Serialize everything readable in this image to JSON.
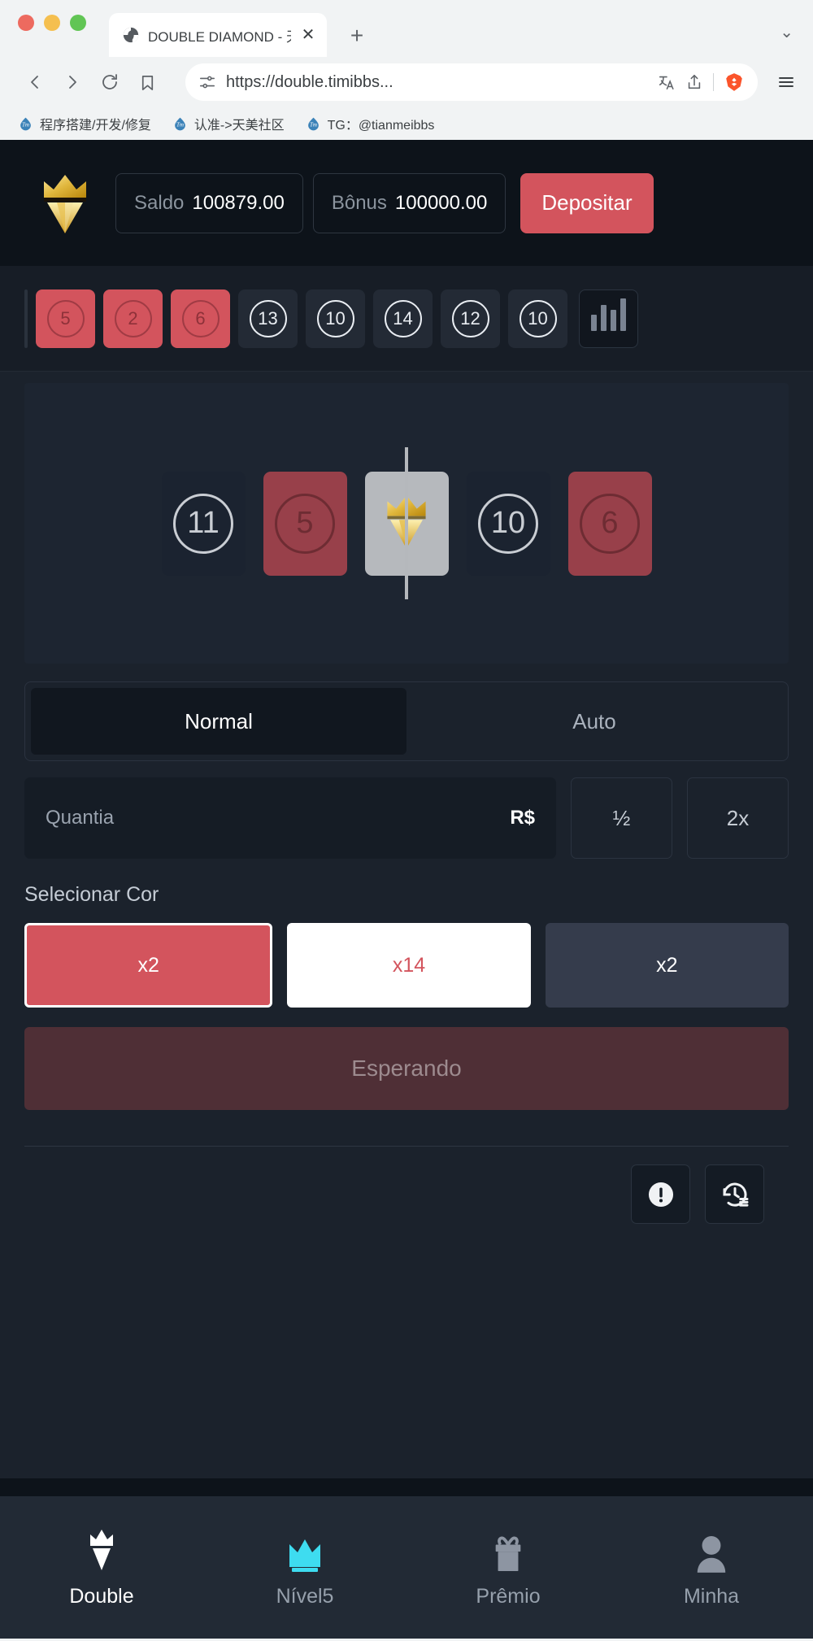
{
  "browser": {
    "tab": {
      "title": "DOUBLE DIAMOND - 天美社区",
      "favicon_icon": "globe-icon",
      "close_label": "✕"
    },
    "new_tab_label": "+",
    "tab_list_label": "⌄",
    "nav": {
      "back_icon": "back-arrow-icon",
      "forward_icon": "forward-arrow-icon",
      "reload_icon": "reload-icon",
      "bookmark_icon": "bookmark-icon"
    },
    "omnibox": {
      "url": "https://double.timibbs...",
      "permissions_icon": "page-settings-icon",
      "translate_icon": "translate-icon",
      "share_icon": "share-icon",
      "shield_icon": "brave-lion-icon"
    },
    "menu_icon": "hamburger-menu-icon",
    "bookmarks": [
      {
        "label": "程序搭建/开发/修复",
        "icon": "tm-bookmark-icon"
      },
      {
        "label": "认准->天美社区",
        "icon": "tm-bookmark-icon"
      },
      {
        "label": "TG：@tianmeibbs",
        "icon": "tm-bookmark-icon"
      }
    ]
  },
  "app": {
    "logo_icon": "gold-crown-diamond-logo",
    "header": {
      "balance_label": "Saldo",
      "balance_value": "100879.00",
      "bonus_label": "Bônus",
      "bonus_value": "100000.00",
      "deposit_label": "Depositar"
    },
    "history": {
      "tiles": [
        {
          "value": "5",
          "color": "red"
        },
        {
          "value": "2",
          "color": "red"
        },
        {
          "value": "6",
          "color": "red"
        },
        {
          "value": "13",
          "color": "dark"
        },
        {
          "value": "10",
          "color": "dark"
        },
        {
          "value": "14",
          "color": "dark"
        },
        {
          "value": "12",
          "color": "dark"
        },
        {
          "value": "10",
          "color": "dark"
        }
      ],
      "stats_icon": "bar-chart-icon"
    },
    "reel": {
      "cards": [
        {
          "value": "11",
          "color": "dark"
        },
        {
          "value": "5",
          "color": "red"
        },
        {
          "value": "",
          "color": "white",
          "icon": "gold-diamond-crown-icon"
        },
        {
          "value": "10",
          "color": "dark"
        },
        {
          "value": "6",
          "color": "red"
        }
      ]
    },
    "modes": [
      {
        "label": "Normal",
        "active": true
      },
      {
        "label": "Auto",
        "active": false
      }
    ],
    "amount": {
      "placeholder": "Quantia",
      "value": "",
      "currency": "R$",
      "half_label": "½",
      "double_label": "2x"
    },
    "selector": {
      "title": "Selecionar Cor",
      "options": [
        {
          "label": "x2",
          "style": "red"
        },
        {
          "label": "x14",
          "style": "white"
        },
        {
          "label": "x2",
          "style": "dark"
        }
      ]
    },
    "bet_button_label": "Esperando",
    "tools": [
      {
        "icon": "info-exclamation-icon"
      },
      {
        "icon": "history-clock-icon"
      }
    ],
    "bottom_nav": [
      {
        "label": "Double",
        "icon": "diamond-crown-icon",
        "state": "active"
      },
      {
        "label": "Nível5",
        "icon": "crown-icon",
        "state": "lvl"
      },
      {
        "label": "Prêmio",
        "icon": "gift-icon",
        "state": "dim"
      },
      {
        "label": "Minha",
        "icon": "person-icon",
        "state": "dim"
      }
    ]
  },
  "colors": {
    "accent_red": "#d3545d",
    "app_bg": "#1b222c",
    "header_bg": "#0d131a",
    "tile_dark": "#353c4c",
    "bet_disabled": "#4f2f36",
    "nav_active_cyan": "#3edcf0"
  }
}
